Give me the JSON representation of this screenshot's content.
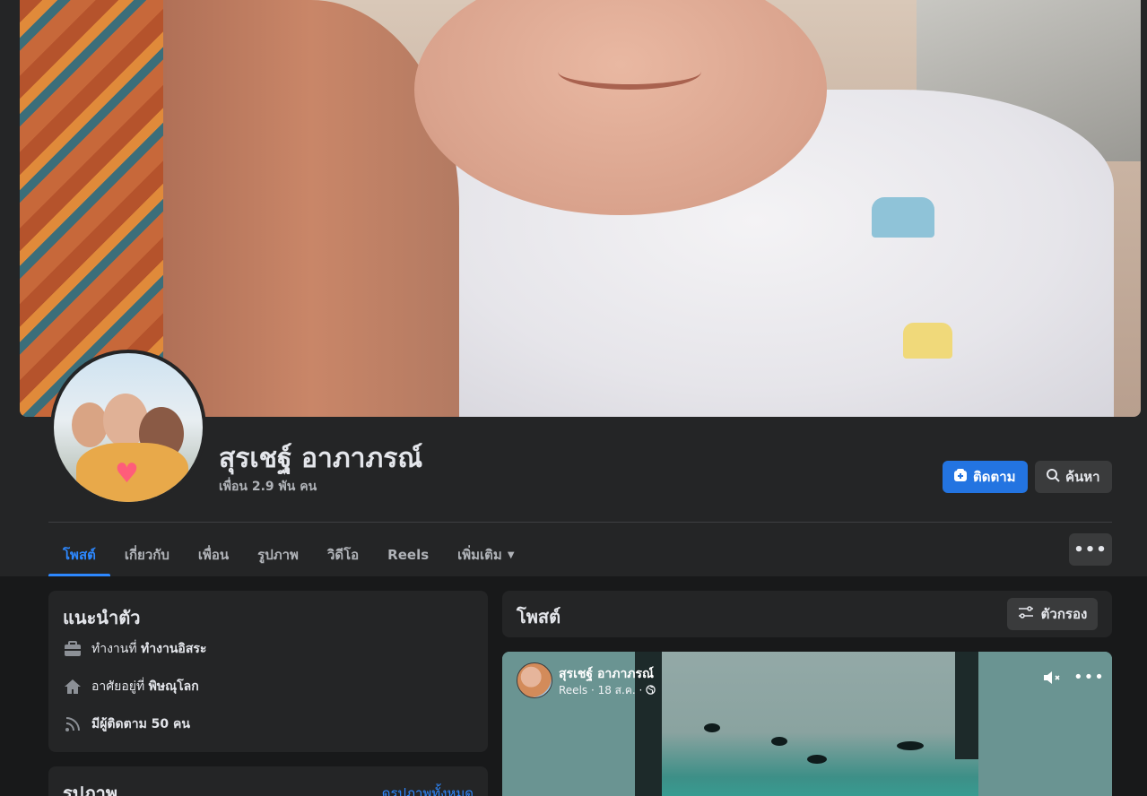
{
  "profile": {
    "name": "สุรเชฐ์ อาภาภรณ์",
    "friends": "เพื่อน 2.9 พัน คน",
    "follow_label": "ติดตาม",
    "search_label": "ค้นหา",
    "more_label": "•••"
  },
  "tabs": [
    {
      "label": "โพสต์"
    },
    {
      "label": "เกี่ยวกับ"
    },
    {
      "label": "เพื่อน"
    },
    {
      "label": "รูปภาพ"
    },
    {
      "label": "วิดีโอ"
    },
    {
      "label": "Reels"
    },
    {
      "label": "เพิ่มเติม"
    }
  ],
  "intro": {
    "title": "แนะนำตัว",
    "work_prefix": "ทำงานที่",
    "work_value": "ทำงานอิสระ",
    "live_prefix": "อาศัยอยู่ที่",
    "live_value": "พิษณุโลก",
    "followers": "มีผู้ติดตาม 50 คน"
  },
  "photos": {
    "title": "รูปภาพ",
    "see_all": "ดูรูปภาพทั้งหมด"
  },
  "posts": {
    "title": "โพสต์",
    "filter_label": "ตัวกรอง"
  },
  "reel": {
    "author": "สุรเชฐ์ อาภาภรณ์",
    "meta": "Reels · 18 ส.ค. · ",
    "more_label": "•••"
  },
  "colors": {
    "accent": "#2d88ff",
    "follow_button": "#2374e1",
    "background": "#18191a",
    "card": "#242526"
  },
  "icons": {
    "follow": "person-add-icon",
    "search": "search-icon",
    "work": "briefcase-icon",
    "home": "home-icon",
    "followers": "rss-icon",
    "filter": "sliders-icon",
    "mute": "muted-speaker-icon",
    "privacy": "globe-icon"
  }
}
